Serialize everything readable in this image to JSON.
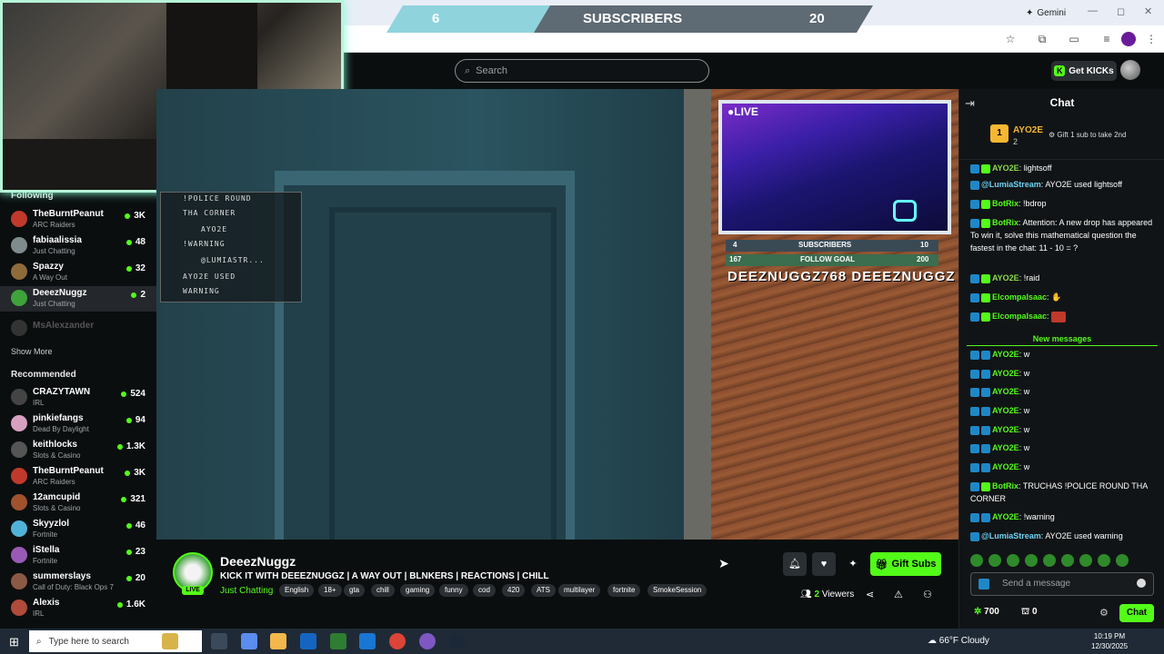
{
  "browser": {
    "gemini_label": "Gemini",
    "win_controls": [
      "—",
      "◻",
      "✕"
    ]
  },
  "sub_banner": {
    "current": "6",
    "label": "SUBSCRIBERS",
    "goal": "20"
  },
  "topnav": {
    "search_placeholder": "Search",
    "get_kicks_label": "Get KICKs"
  },
  "sidebar": {
    "following_heading": "Following",
    "following": [
      {
        "name": "TheBurntPeanut",
        "category": "ARC Raiders",
        "viewers": "3K",
        "color": "#c0392b"
      },
      {
        "name": "fabiaalissia",
        "category": "Just Chatting",
        "viewers": "48",
        "color": "#7f8c8d"
      },
      {
        "name": "Spazzy",
        "category": "A Way Out",
        "viewers": "32",
        "color": "#8e6b3a"
      },
      {
        "name": "DeeezNuggz",
        "category": "Just Chatting",
        "viewers": "2",
        "color": "#3ea33b"
      }
    ],
    "offline_name": "MsAlexzander",
    "show_more": "Show More",
    "recommended_heading": "Recommended",
    "recommended": [
      {
        "name": "CRAZYTAWN",
        "category": "IRL",
        "viewers": "524",
        "color": "#444"
      },
      {
        "name": "pinkiefangs",
        "category": "Dead By Daylight",
        "viewers": "94",
        "color": "#d7a0c0"
      },
      {
        "name": "keithlocks",
        "category": "Slots & Casino",
        "viewers": "1.3K",
        "color": "#555"
      },
      {
        "name": "TheBurntPeanut",
        "category": "ARC Raiders",
        "viewers": "3K",
        "color": "#c0392b"
      },
      {
        "name": "12amcupid",
        "category": "Slots & Casino",
        "viewers": "321",
        "color": "#a0522d"
      },
      {
        "name": "Skyyzlol",
        "category": "Fortnite",
        "viewers": "46",
        "color": "#4fb3d9"
      },
      {
        "name": "iStella",
        "category": "Fortnite",
        "viewers": "23",
        "color": "#9b59b6"
      },
      {
        "name": "summerslays",
        "category": "Call of Duty: Black Ops 7",
        "viewers": "20",
        "color": "#8a5a44"
      },
      {
        "name": "Alexis",
        "category": "IRL",
        "viewers": "1.6K",
        "color": "#b04a3a"
      }
    ]
  },
  "video_overlay": {
    "chat_lines": [
      "!POLICE ROUND",
      "THA CORNER",
      "AYO2E",
      "!WARNING",
      "@LUMIASTR...",
      "AYO2E USED",
      "WARNING"
    ],
    "live_label": "●LIVE",
    "subs_current": "4",
    "subs_label": "SUBSCRIBERS",
    "subs_goal": "10",
    "follow_current": "167",
    "follow_label": "FOLLOW GOAL",
    "follow_goal": "200",
    "socials": "DEEZNUGGZ768  DEEEZNUGGZ"
  },
  "stream_info": {
    "streamer": "DeeezNuggz",
    "live_badge": "LIVE",
    "title": "KICK IT WITH DEEEZNUGGZ | A WAY OUT | BLNKERS | REACTIONS | CHILL",
    "category": "Just Chatting",
    "tags": [
      "English",
      "18+",
      "gta",
      "chill",
      "gaming",
      "funny",
      "cod",
      "420",
      "ATS",
      "multilayer",
      "fortnite",
      "SmokeSession"
    ],
    "gift_subs_label": "Gift Subs",
    "viewer_count": "2",
    "viewers_label": "Viewers"
  },
  "chat": {
    "title": "Chat",
    "pinned": {
      "rank": "1",
      "user": "AYO2E",
      "count": "2",
      "gift_text": "Gift 1 sub to take 2nd"
    },
    "messages": [
      {
        "user": "AYO2E",
        "text": "lightsoff",
        "color": "u-gold"
      },
      {
        "user": "@LumiaStream",
        "text": "AYO2E used lightsoff",
        "color": "u-blue"
      },
      {
        "user": "BotRix",
        "text": "!bdrop",
        "color": "u-green"
      },
      {
        "user": "BotRix",
        "text": "Attention: A new drop has appeared  To win it, solve this mathematical question the fastest in the chat: 11 - 10 = ?",
        "color": "u-green"
      },
      {
        "user": "AYO2E",
        "text": "!raid",
        "color": "u-gold"
      },
      {
        "user": "Elcompalsaac",
        "text": "",
        "color": "u-green"
      },
      {
        "user": "Elcompalsaac",
        "text": "",
        "color": "u-green"
      }
    ],
    "new_messages_label": "New messages",
    "new_messages": [
      {
        "user": "AYO2E",
        "text": "w"
      },
      {
        "user": "AYO2E",
        "text": "w"
      },
      {
        "user": "AYO2E",
        "text": "w"
      },
      {
        "user": "AYO2E",
        "text": "w"
      },
      {
        "user": "AYO2E",
        "text": "w"
      },
      {
        "user": "AYO2E",
        "text": "w"
      },
      {
        "user": "AYO2E",
        "text": "w"
      }
    ],
    "botrix_last": {
      "user": "BotRix",
      "text": "TRUCHAS !POLICE ROUND THA CORNER"
    },
    "ayo_warning": {
      "user": "AYO2E",
      "text": "!warning"
    },
    "lumia_last": {
      "user": "@LumiaStream",
      "text": "AYO2E used warning"
    },
    "input_placeholder": "Send a message",
    "points": "700",
    "boxes": "0",
    "send_label": "Chat"
  },
  "taskbar": {
    "search_placeholder": "Type here to search",
    "weather": "66°F  Cloudy",
    "time": "10:19 PM",
    "date": "12/30/2025"
  }
}
